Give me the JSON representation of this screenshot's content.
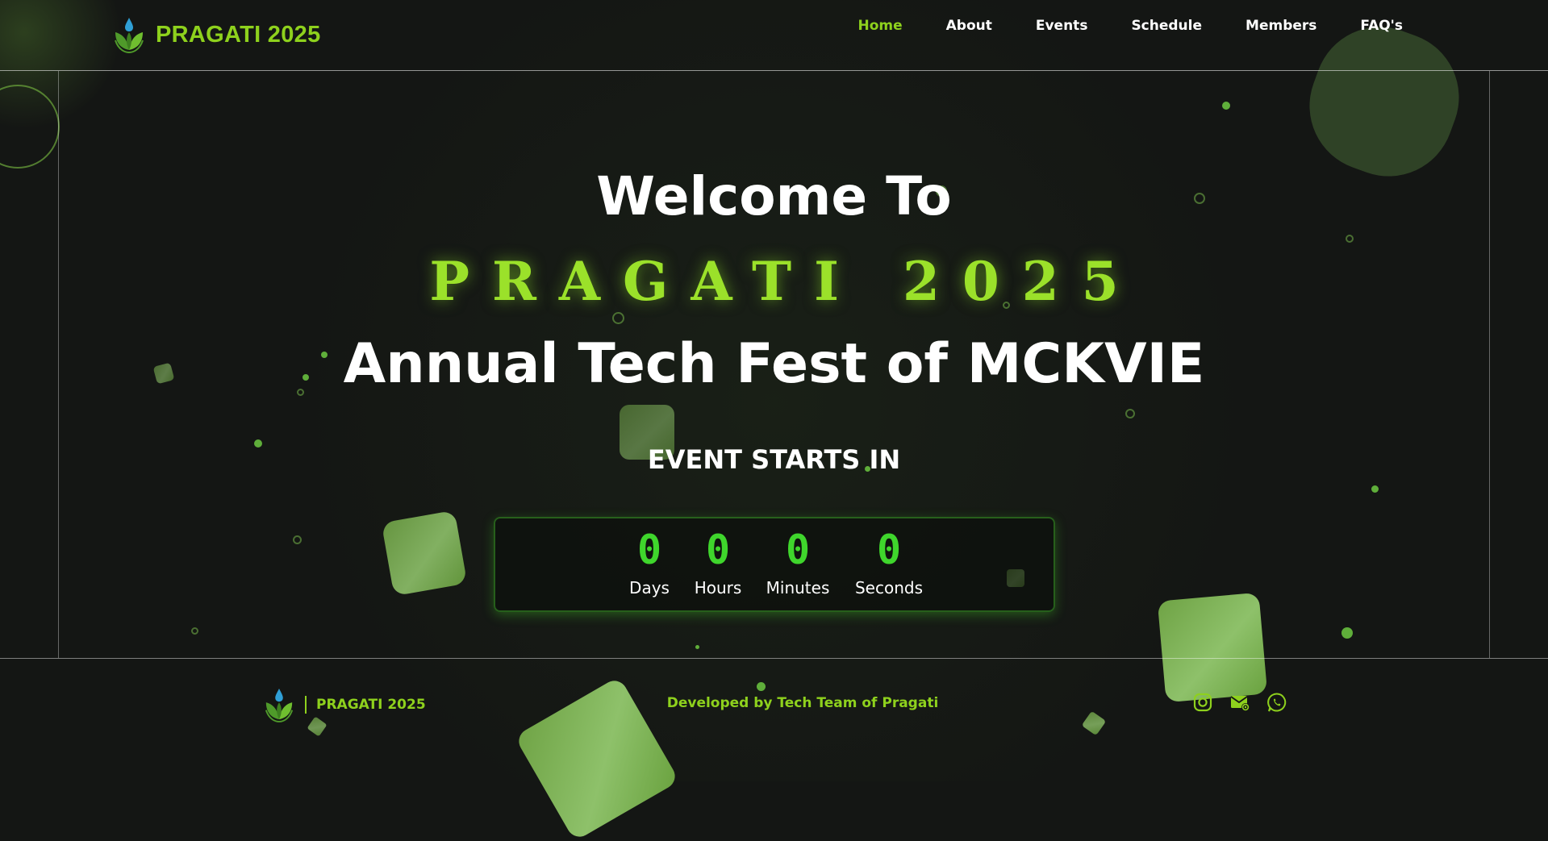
{
  "brand": {
    "name": "PRAGATI 2025"
  },
  "nav": {
    "items": [
      {
        "label": "Home",
        "active": true
      },
      {
        "label": "About"
      },
      {
        "label": "Events"
      },
      {
        "label": "Schedule"
      },
      {
        "label": "Members"
      },
      {
        "label": "FAQ's"
      }
    ]
  },
  "hero": {
    "welcome": "Welcome To",
    "fest_name": "PRAGATI 2025",
    "tagline": "Annual Tech Fest of MCKVIE",
    "event_starts": "EVENT STARTS IN"
  },
  "countdown": {
    "units": [
      {
        "value": "0",
        "label": "Days"
      },
      {
        "value": "0",
        "label": "Hours"
      },
      {
        "value": "0",
        "label": "Minutes"
      },
      {
        "value": "0",
        "label": "Seconds"
      }
    ]
  },
  "footer": {
    "brand_name": "PRAGATI 2025",
    "credit": "Developed by Tech Team of Pragati",
    "socials": [
      "instagram-icon",
      "email-icon",
      "whatsapp-icon"
    ]
  },
  "colors": {
    "accent": "#8ed11d",
    "countdown_digit": "#3fd62c",
    "background": "#141614"
  }
}
